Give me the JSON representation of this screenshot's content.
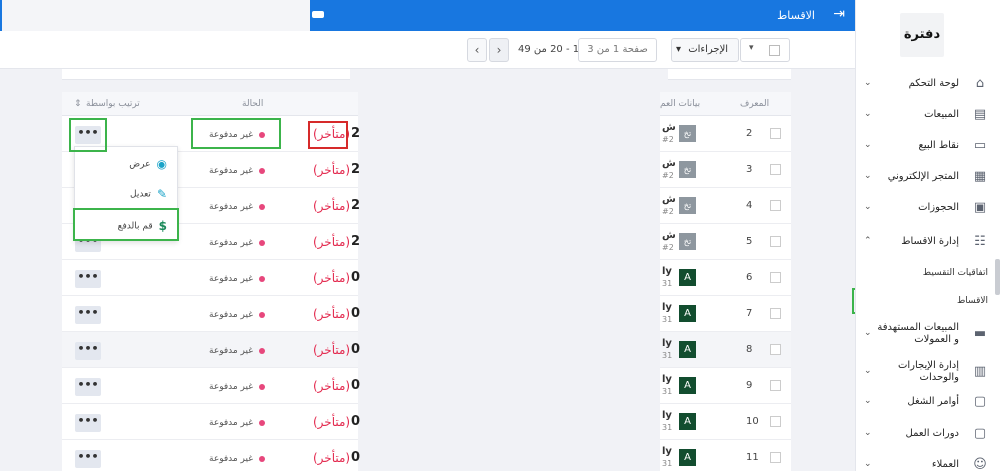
{
  "header": {
    "title": "الاقساط"
  },
  "toolbar": {
    "actions_label": "الإجراءات",
    "page_label": "صفحة 1 من 3",
    "range_label": "1 - 20 من 49",
    "prev_icon": "chevron-left-icon",
    "next_icon": "chevron-right-icon"
  },
  "table": {
    "headers": {
      "sort_by": "ترتيب بواسطة",
      "status": "الحالة",
      "client": "بيانات العم",
      "id": "المعرف"
    },
    "rows": [
      {
        "id": "2",
        "amount": "2",
        "late": "(متأخر)",
        "status": "غير مدفوعة",
        "avatar": "تخ",
        "client": "ش",
        "ref": "#2"
      },
      {
        "id": "3",
        "amount": "2",
        "late": "(متأخر)",
        "status": "غير مدفوعة",
        "avatar": "تخ",
        "client": "ش",
        "ref": "#2"
      },
      {
        "id": "4",
        "amount": "2",
        "late": "(متأخر)",
        "status": "غير مدفوعة",
        "avatar": "تخ",
        "client": "ش",
        "ref": "#2"
      },
      {
        "id": "5",
        "amount": "2",
        "late": "(متأخر)",
        "status": "غير مدفوعة",
        "avatar": "تخ",
        "client": "ش",
        "ref": "#2"
      },
      {
        "id": "6",
        "amount": "0",
        "late": "(متأخر)",
        "status": "غير مدفوعة",
        "avatar": "A",
        "client": "ly",
        "ref": "31"
      },
      {
        "id": "7",
        "amount": "0",
        "late": "(متأخر)",
        "status": "غير مدفوعة",
        "avatar": "A",
        "client": "ly",
        "ref": "31"
      },
      {
        "id": "8",
        "amount": "0",
        "late": "(متأخر)",
        "status": "غير مدفوعة",
        "avatar": "A",
        "client": "ly",
        "ref": "31"
      },
      {
        "id": "9",
        "amount": "0",
        "late": "(متأخر)",
        "status": "غير مدفوعة",
        "avatar": "A",
        "client": "ly",
        "ref": "31"
      },
      {
        "id": "10",
        "amount": "0",
        "late": "(متأخر)",
        "status": "غير مدفوعة",
        "avatar": "A",
        "client": "ly",
        "ref": "31"
      },
      {
        "id": "11",
        "amount": "0",
        "late": "(متأخر)",
        "status": "غير مدفوعة",
        "avatar": "A",
        "client": "ly",
        "ref": "31"
      }
    ]
  },
  "dropdown": {
    "view": "عرض",
    "edit": "تعديل",
    "pay": "قم بالدفع"
  },
  "sidebar": {
    "logo": "دفترة",
    "items": [
      {
        "label": "لوحة التحكم",
        "icon": "home-icon"
      },
      {
        "label": "المبيعات",
        "icon": "invoice-icon"
      },
      {
        "label": "نقاط البيع",
        "icon": "pos-icon"
      },
      {
        "label": "المتجر الإلكتروني",
        "icon": "store-icon"
      },
      {
        "label": "الحجوزات",
        "icon": "calendar-icon"
      },
      {
        "label": "إدارة الاقساط",
        "icon": "installments-icon"
      }
    ],
    "sub_items": [
      "اتفاقيات التقسيط",
      "الاقساط"
    ],
    "items_after": [
      {
        "label_line1": "المبيعات المستهدفة",
        "label_line2": "و العمولات",
        "icon": "money-icon"
      },
      {
        "label_line1": "إدارة الإيجارات",
        "label_line2": "والوحدات",
        "icon": "building-icon"
      },
      {
        "label": "أوامر الشغل",
        "icon": "clipboard-icon"
      },
      {
        "label": "دورات العمل",
        "icon": "workflow-icon"
      },
      {
        "label": "العملاء",
        "icon": "users-icon"
      }
    ]
  },
  "colors": {
    "brand": "#1877e0",
    "late": "#e3294e",
    "unpaid_dot": "#e7477c",
    "highlight": "#3cb44b"
  }
}
